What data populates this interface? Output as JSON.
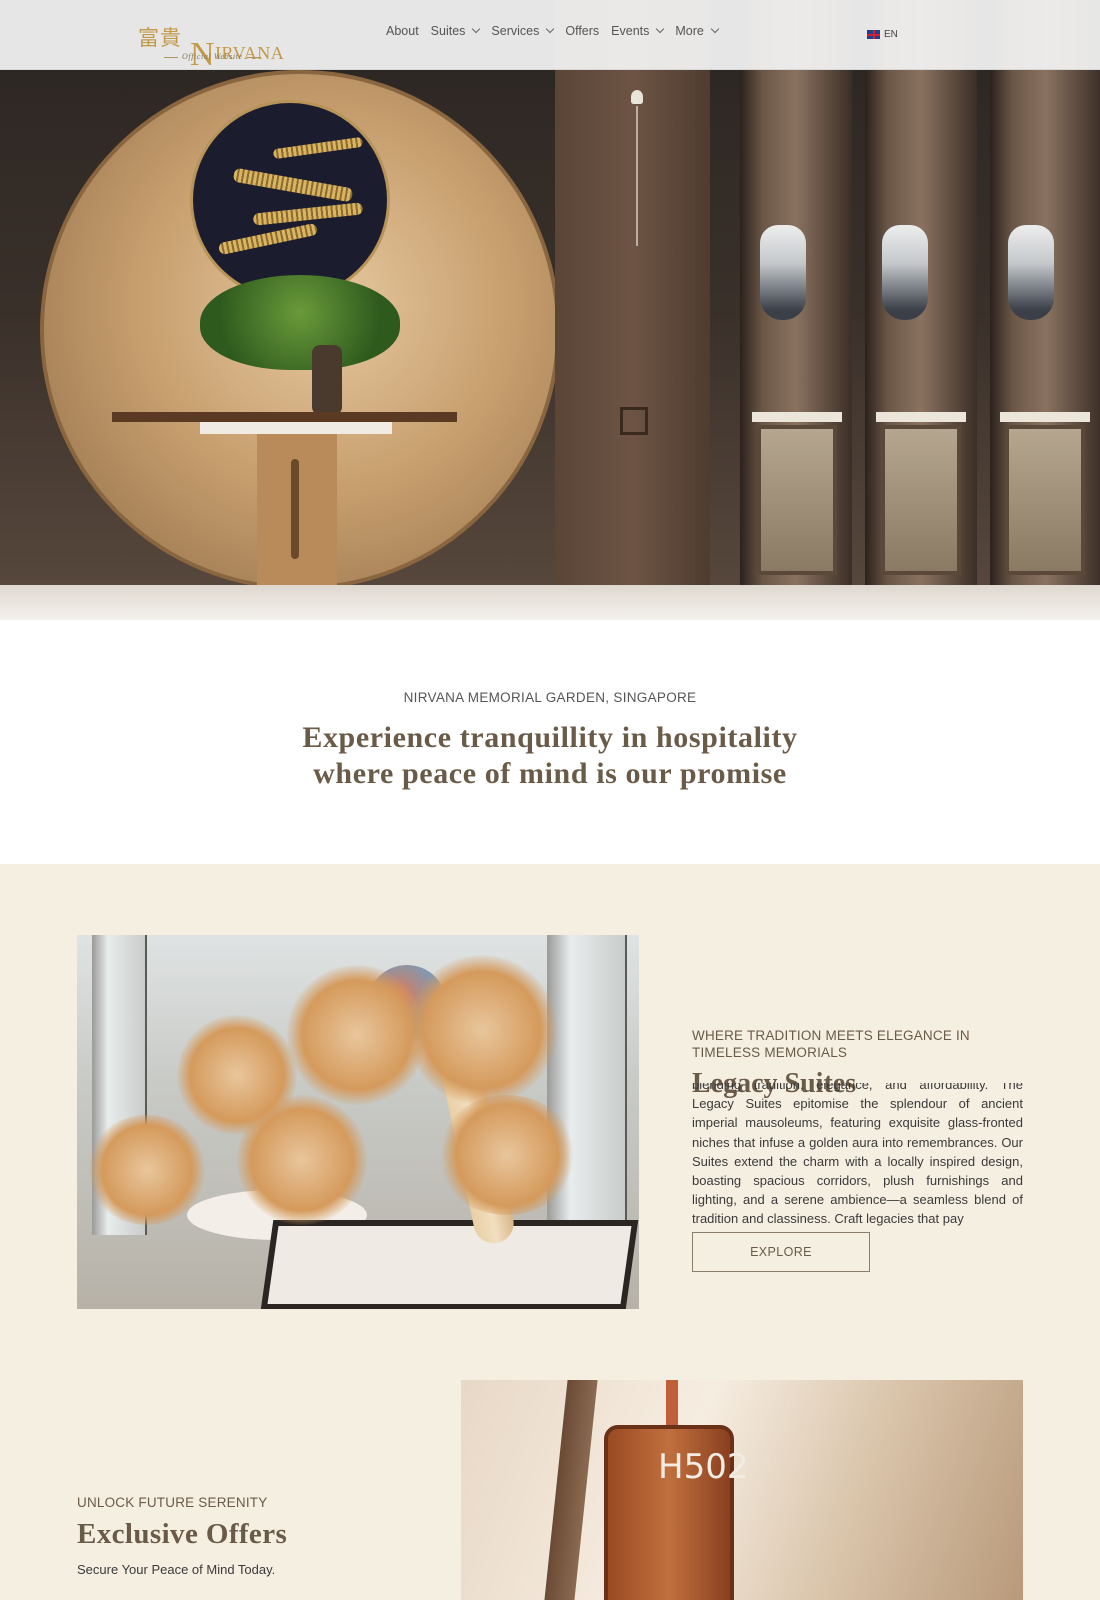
{
  "header": {
    "logo_cjk": "富貴",
    "logo_name_initial": "N",
    "logo_name_rest": "IRVANA",
    "logo_tagline": "Official Website",
    "nav": [
      {
        "label": "About",
        "has_dropdown": false
      },
      {
        "label": "Suites",
        "has_dropdown": true
      },
      {
        "label": "Services",
        "has_dropdown": true
      },
      {
        "label": "Offers",
        "has_dropdown": false
      },
      {
        "label": "Events",
        "has_dropdown": true
      },
      {
        "label": "More",
        "has_dropdown": true
      }
    ],
    "language": {
      "label": "EN",
      "flag_icon": "uk-flag-icon"
    }
  },
  "intro": {
    "kicker": "NIRVANA MEMORIAL GARDEN, SINGAPORE",
    "title_line1": "Experience tranquillity in hospitality",
    "title_line2": "where peace of mind is our promise"
  },
  "legacy": {
    "kicker": "WHERE TRADITION MEETS ELEGANCE IN TIMELESS MEMORIALS",
    "title": "Legacy Suites",
    "body": "blending tradition, elegance, and affordability. The Legacy Suites epitomise the splendour of ancient imperial mausoleums, featuring exquisite glass-fronted niches that infuse a golden aura into remembrances. Our Suites extend the charm with a locally inspired design, boasting spacious corridors, plush furnishings and lighting, and a serene ambience—a seamless blend of tradition and classiness. Craft legacies that pay",
    "button_label": "EXPLORE"
  },
  "offers": {
    "kicker": "UNLOCK FUTURE SERENITY",
    "title": "Exclusive Offers",
    "subtitle": "Secure Your Peace of Mind Today.",
    "sign_text": "H502"
  },
  "colors": {
    "accent_gold": "#c39a49",
    "heading_brown": "#6a5a48",
    "section_bg": "#f5efe2"
  }
}
